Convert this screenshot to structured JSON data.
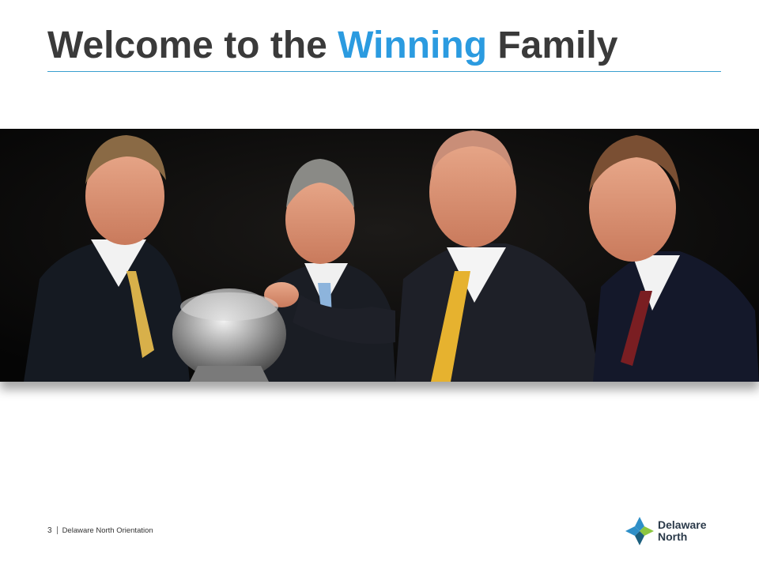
{
  "slide": {
    "title_part1": "Welcome to the ",
    "title_accent": "Winning",
    "title_part2": " Family",
    "accent_color": "#2b9be0",
    "title_color": "#3a3a3a"
  },
  "photo": {
    "subject": "four men in dark suits holding a silver trophy cup"
  },
  "footer": {
    "page_number": "3",
    "text": "Delaware North Orientation"
  },
  "logo": {
    "line1": "Delaware",
    "line2": "North",
    "icon": "compass-star-icon",
    "colors": [
      "#2e8fc8",
      "#1c5f7e",
      "#8cc63f"
    ]
  }
}
